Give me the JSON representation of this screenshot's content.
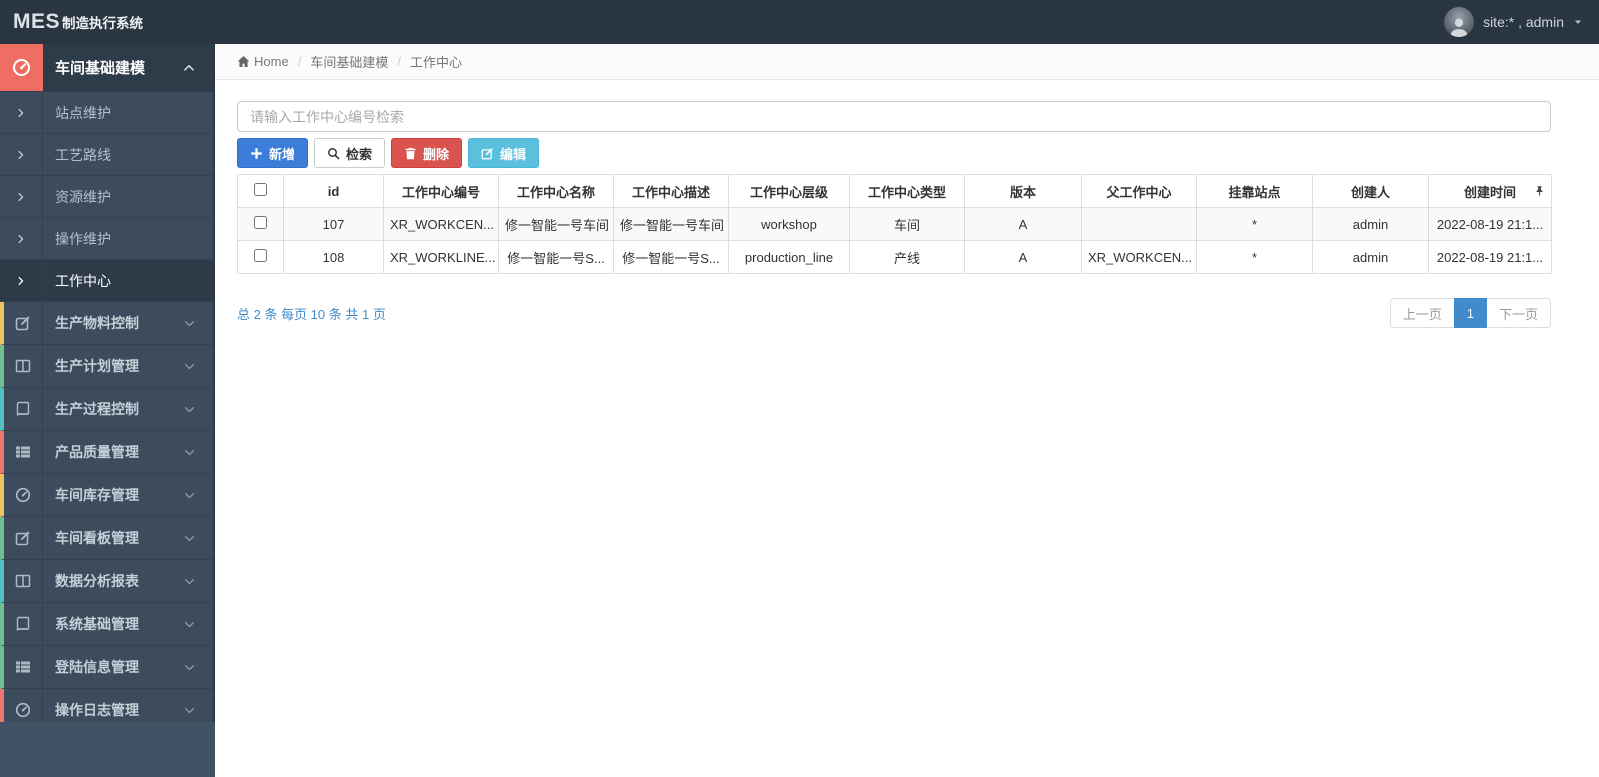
{
  "topbar": {
    "brand_primary": "MES",
    "brand_secondary": "制造执行系统",
    "user_label": "site:* , admin"
  },
  "sidebar": {
    "parent": {
      "label": "车间基础建模",
      "icon": "tachometer-icon",
      "icon_bg": "#ee6e64"
    },
    "children": [
      {
        "label": "站点维护",
        "active": false
      },
      {
        "label": "工艺路线",
        "active": false
      },
      {
        "label": "资源维护",
        "active": false
      },
      {
        "label": "操作维护",
        "active": false
      },
      {
        "label": "工作中心",
        "active": true
      }
    ],
    "items": [
      {
        "label": "生产物料控制",
        "icon": "pencil-square-icon",
        "accent": "#eec35e"
      },
      {
        "label": "生产计划管理",
        "icon": "columns-icon",
        "accent": "#6fbf8e"
      },
      {
        "label": "生产过程控制",
        "icon": "book-icon",
        "accent": "#52c1c4"
      },
      {
        "label": "产品质量管理",
        "icon": "th-list-icon",
        "accent": "#ee7572"
      },
      {
        "label": "车间库存管理",
        "icon": "tachometer-icon",
        "accent": "#eec35e"
      },
      {
        "label": "车间看板管理",
        "icon": "pencil-square-icon",
        "accent": "#6fbf8e"
      },
      {
        "label": "数据分析报表",
        "icon": "columns-icon",
        "accent": "#52c1c4"
      },
      {
        "label": "系统基础管理",
        "icon": "book-icon",
        "accent": "#6fbf8e"
      },
      {
        "label": "登陆信息管理",
        "icon": "th-list-icon",
        "accent": "#6fbf8e"
      },
      {
        "label": "操作日志管理",
        "icon": "tachometer-icon",
        "accent": "#ee7572"
      }
    ]
  },
  "breadcrumb": {
    "home": "Home",
    "section": "车间基础建模",
    "page": "工作中心"
  },
  "toolbar": {
    "search_placeholder": "请输入工作中心编号检索",
    "add_label": "新增",
    "search_label": "检索",
    "delete_label": "删除",
    "edit_label": "编辑"
  },
  "table": {
    "columns": [
      "id",
      "工作中心编号",
      "工作中心名称",
      "工作中心描述",
      "工作中心层级",
      "工作中心类型",
      "版本",
      "父工作中心",
      "挂靠站点",
      "创建人",
      "创建时间"
    ],
    "rows": [
      {
        "cells": [
          "107",
          "XR_WORKCEN...",
          "修一智能一号车间",
          "修一智能一号车间",
          "workshop",
          "车间",
          "A",
          "",
          "*",
          "admin",
          "2022-08-19 21:1..."
        ]
      },
      {
        "cells": [
          "108",
          "XR_WORKLINE...",
          "修一智能一号S...",
          "修一智能一号S...",
          "production_line",
          "产线",
          "A",
          "XR_WORKCEN...",
          "*",
          "admin",
          "2022-08-19 21:1..."
        ]
      }
    ]
  },
  "pagination": {
    "summary": "总 2 条 每页 10 条 共 1 页",
    "prev_label": "上一页",
    "current_page": "1",
    "next_label": "下一页"
  },
  "colors": {
    "topbar_bg": "#2a3542",
    "sidebar_bg": "#3c4c5d",
    "parent_icon_bg": "#ee6e64",
    "primary_button": "#3b7dd8",
    "danger_button": "#d9534f",
    "info_button": "#5bc0de",
    "link_blue": "#428bca"
  }
}
